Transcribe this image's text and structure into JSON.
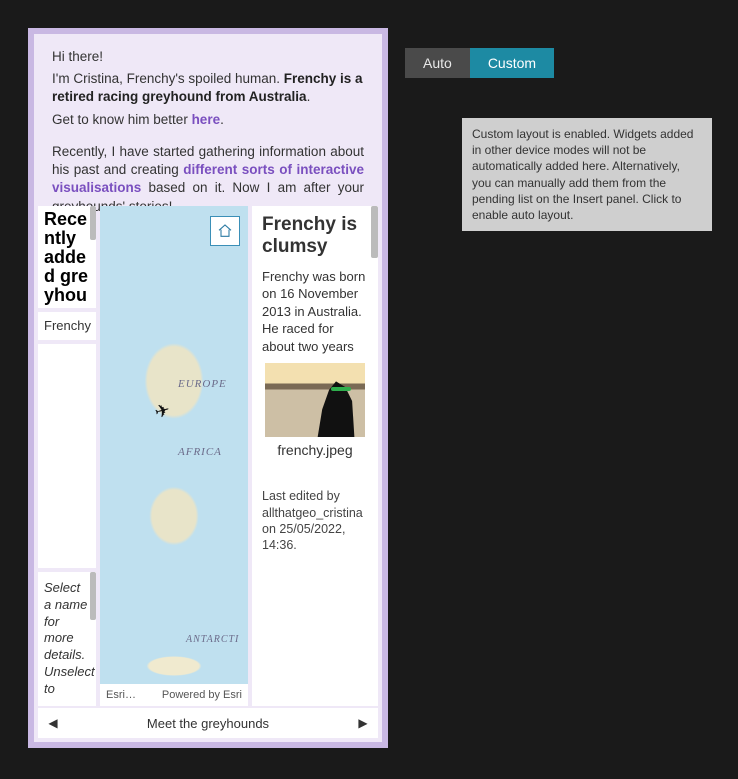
{
  "intro": {
    "greeting": "Hi there!",
    "line2a": "I'm Cristina, Frenchy's spoiled human. ",
    "line2b_bold": "Frenchy is a retired racing greyhound from Australia",
    "line2c": ".",
    "line3a": "Get to know him better ",
    "line3b_link": "here",
    "line3c": ".",
    "para2a": "Recently, I have started gathering information about his past and creating ",
    "para2b_link": "different sorts of interactive visualisations",
    "para2c": " based on it. Now I am after your greyhounds' stories!"
  },
  "left": {
    "heading": "Recently added greyhou",
    "list_item": "Frenchy",
    "hint": "Select a name for more details. Unselect to"
  },
  "map": {
    "labels": {
      "europe": "EUROPE",
      "africa": "AFRICA",
      "antarctica": "ANTARCTI"
    },
    "attribution_left": "Esri…",
    "attribution_right": "Powered by Esri"
  },
  "detail": {
    "title": "Frenchy is clumsy",
    "body": "Frenchy was born on 16 November 2013 in Australia. He raced for about two years",
    "image_caption": "frenchy.jpeg",
    "last_edited": "Last edited by allthatgeo_cristina on 25/05/2022, 14:36."
  },
  "footer": {
    "title": "Meet the greyhounds"
  },
  "toggle": {
    "auto": "Auto",
    "custom": "Custom"
  },
  "tooltip": "Custom layout is enabled. Widgets added in other device modes will not be automatically added here. Alternatively, you can manually add them from the pending list on the Insert panel. Click to enable auto layout."
}
